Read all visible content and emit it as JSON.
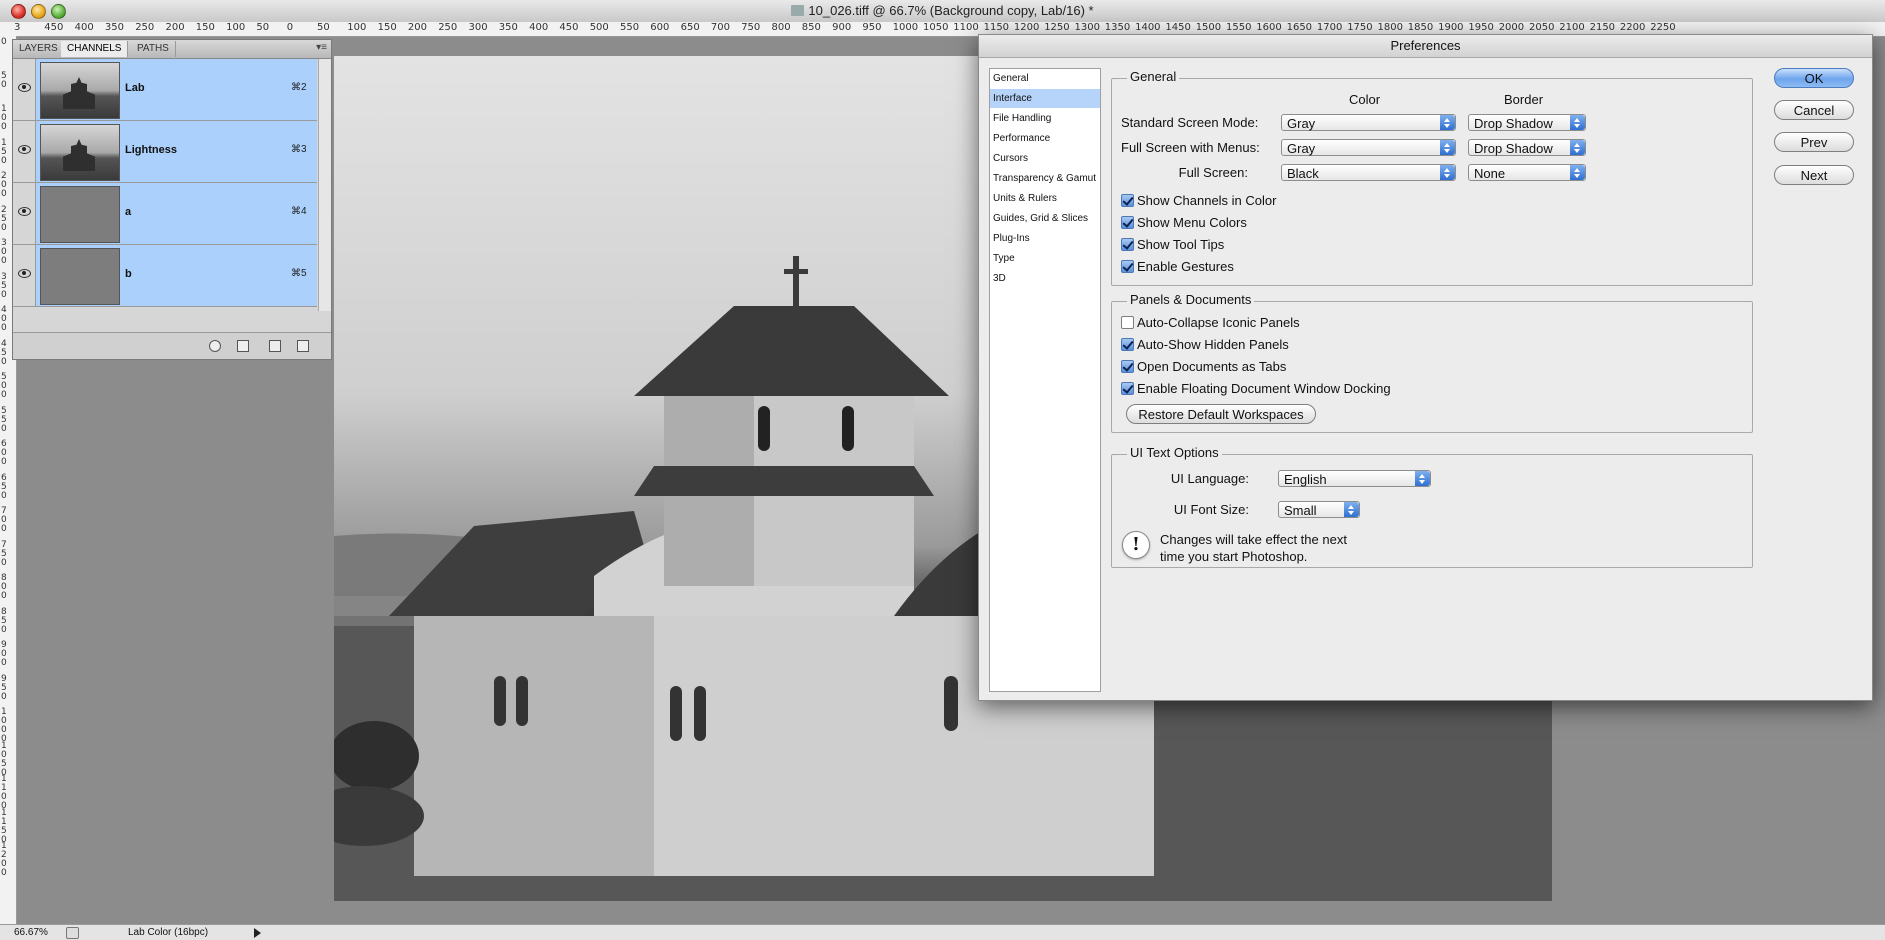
{
  "window": {
    "title": "10_026.tiff @ 66.7% (Background copy, Lab/16) *"
  },
  "rulers": {
    "top": [
      "3",
      "450",
      "400",
      "350",
      "250",
      "200",
      "150",
      "100",
      "50",
      "0",
      "50",
      "100",
      "150",
      "200",
      "250",
      "300",
      "350",
      "400",
      "450",
      "500",
      "550",
      "600",
      "650",
      "700",
      "750",
      "800",
      "850",
      "900",
      "950",
      "1000",
      "1050",
      "1100",
      "1150",
      "1200",
      "1250",
      "1300",
      "1350",
      "1400",
      "1450",
      "1500",
      "1550",
      "1600",
      "1650",
      "1700",
      "1750",
      "1800",
      "1850",
      "1900",
      "1950",
      "2000",
      "2050",
      "2100",
      "2150",
      "2200",
      "2250"
    ],
    "left": [
      "0",
      "50",
      "100",
      "150",
      "200",
      "250",
      "300",
      "350",
      "400",
      "450",
      "500",
      "550",
      "600",
      "650",
      "700",
      "750",
      "800",
      "850",
      "900",
      "950",
      "1000",
      "1050",
      "1100",
      "1150",
      "1200"
    ]
  },
  "channels_panel": {
    "tabs": [
      {
        "label": "LAYERS",
        "active": false
      },
      {
        "label": "CHANNELS",
        "active": true
      },
      {
        "label": "PATHS",
        "active": false
      }
    ],
    "menu_glyph": "▾≡",
    "collapse_glyph": "◂◂",
    "channels": [
      {
        "name": "Lab",
        "shortcut": "⌘2",
        "thumb": "photo"
      },
      {
        "name": "Lightness",
        "shortcut": "⌘3",
        "thumb": "photo"
      },
      {
        "name": "a",
        "shortcut": "⌘4",
        "thumb": "gray"
      },
      {
        "name": "b",
        "shortcut": "⌘5",
        "thumb": "gray"
      }
    ],
    "footer_icons": [
      "load-selection-icon",
      "save-selection-icon",
      "new-channel-icon",
      "delete-channel-icon"
    ]
  },
  "status_bar": {
    "zoom": "66.67%",
    "doc_info": "Lab Color (16bpc)"
  },
  "preferences": {
    "title": "Preferences",
    "nav": [
      {
        "label": "General",
        "selected": false
      },
      {
        "label": "Interface",
        "selected": true
      },
      {
        "label": "File Handling",
        "selected": false
      },
      {
        "label": "Performance",
        "selected": false
      },
      {
        "label": "Cursors",
        "selected": false
      },
      {
        "label": "Transparency & Gamut",
        "selected": false
      },
      {
        "label": "Units & Rulers",
        "selected": false
      },
      {
        "label": "Guides, Grid & Slices",
        "selected": false
      },
      {
        "label": "Plug-Ins",
        "selected": false
      },
      {
        "label": "Type",
        "selected": false
      },
      {
        "label": "3D",
        "selected": false
      }
    ],
    "general_group": {
      "title": "General",
      "color_header": "Color",
      "border_header": "Border",
      "modes": [
        {
          "label": "Standard Screen Mode:",
          "color": "Gray",
          "border": "Drop Shadow"
        },
        {
          "label": "Full Screen with Menus:",
          "color": "Gray",
          "border": "Drop Shadow"
        },
        {
          "label": "Full Screen:",
          "color": "Black",
          "border": "None"
        }
      ],
      "checkboxes": [
        {
          "label": "Show Channels in Color",
          "checked": true
        },
        {
          "label": "Show Menu Colors",
          "checked": true
        },
        {
          "label": "Show Tool Tips",
          "checked": true
        },
        {
          "label": "Enable Gestures",
          "checked": true
        }
      ]
    },
    "panels_group": {
      "title": "Panels & Documents",
      "checkboxes": [
        {
          "label": "Auto-Collapse Iconic Panels",
          "checked": false
        },
        {
          "label": "Auto-Show Hidden Panels",
          "checked": true
        },
        {
          "label": "Open Documents as Tabs",
          "checked": true
        },
        {
          "label": "Enable Floating Document Window Docking",
          "checked": true
        }
      ],
      "restore_button": "Restore Default Workspaces"
    },
    "ui_text_group": {
      "title": "UI Text Options",
      "language_label": "UI Language:",
      "language_value": "English",
      "font_size_label": "UI Font Size:",
      "font_size_value": "Small",
      "note_line1": "Changes will take effect the next",
      "note_line2": "time you start Photoshop.",
      "note_icon": "!"
    },
    "buttons": {
      "ok": "OK",
      "cancel": "Cancel",
      "prev": "Prev",
      "next": "Next"
    }
  }
}
